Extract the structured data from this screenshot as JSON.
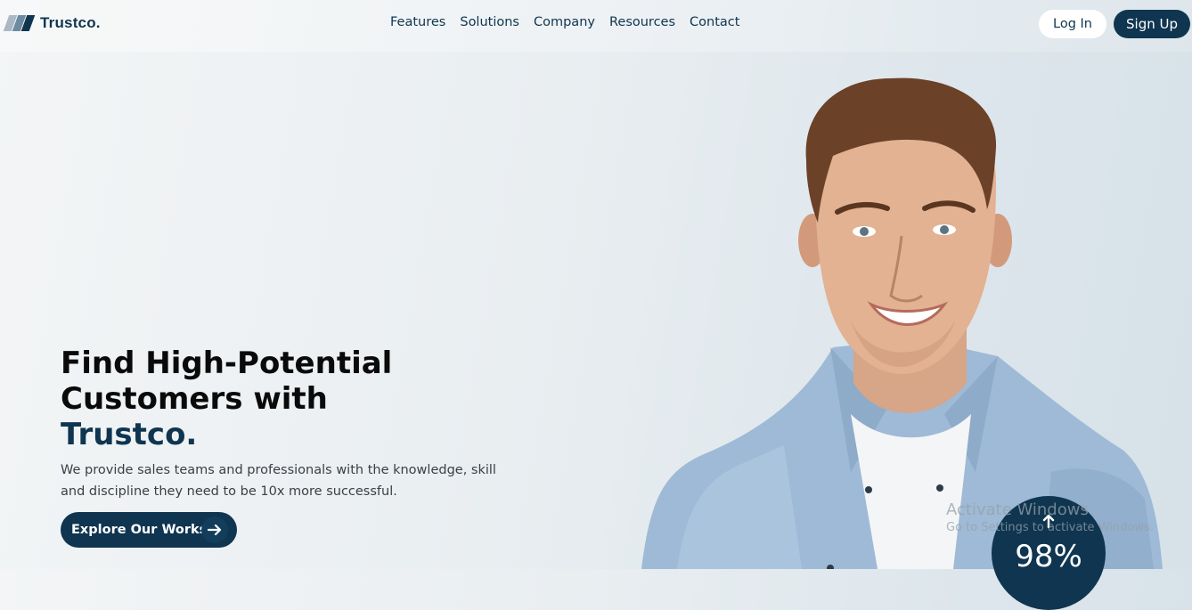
{
  "header": {
    "logo_text": "Trustco.",
    "nav": [
      "Features",
      "Solutions",
      "Company",
      "Resources",
      "Contact"
    ],
    "login_label": "Log In",
    "signup_label": "Sign Up"
  },
  "hero": {
    "title_line1": "Find High-Potential",
    "title_line2": "Customers with",
    "title_brand": "Trustco.",
    "description": "We provide sales teams and professionals with the knowledge, skill and discipline they need to be 10x more successful.",
    "cta_label": "Explore Our Works",
    "cta_icon": "arrow-right-icon"
  },
  "stat": {
    "value": "98%",
    "icon": "arrow-up-icon"
  },
  "watermark": {
    "title": "Activate Windows",
    "subtitle": "Go to Settings to activate Windows."
  },
  "colors": {
    "brand_navy": "#0f3550",
    "logo_light": "#8fa3b3",
    "logo_mid": "#50708a"
  }
}
